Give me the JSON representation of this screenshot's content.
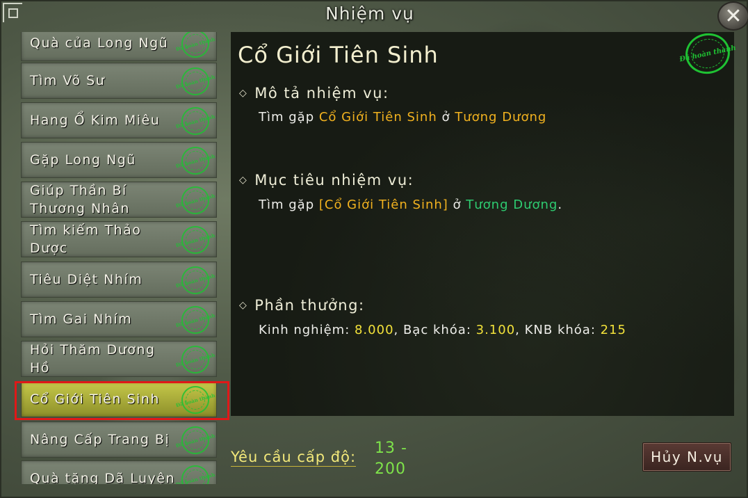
{
  "window": {
    "title": "Nhiệm vụ",
    "close_symbol": "✕"
  },
  "quest_list": {
    "items": [
      {
        "label": "Quà của Long Ngũ",
        "status": "Đã hoàn thành"
      },
      {
        "label": "Tìm Võ Sư",
        "status": "Đã hoàn thành"
      },
      {
        "label": "Hang Ổ Kim Miêu",
        "status": "Đã hoàn thành"
      },
      {
        "label": "Gặp Long Ngũ",
        "status": "Đã hoàn thành"
      },
      {
        "label": "Giúp Thần Bí Thương Nhân",
        "status": "Đã hoàn thành"
      },
      {
        "label": "Tìm kiếm Thảo Dược",
        "status": "Đã hoàn thành"
      },
      {
        "label": "Tiêu Diệt Nhím",
        "status": "Đã hoàn thành"
      },
      {
        "label": "Tìm Gai Nhím",
        "status": "Đã hoàn thành"
      },
      {
        "label": "Hỏi Thăm Dương Hồ",
        "status": "Đã hoàn thành"
      },
      {
        "label": "Cổ Giới Tiên Sinh",
        "status": "Đã hoàn thành",
        "selected": true
      },
      {
        "label": "Nâng Cấp Trang Bị",
        "status": "Đã hoàn thành"
      },
      {
        "label": "Quà tặng Dã Luyện",
        "status": "Đã hoàn thành"
      }
    ]
  },
  "detail": {
    "title": "Cổ Giới Tiên Sinh",
    "status_stamp": "Đã hoàn thành",
    "description": {
      "heading": "Mô tả nhiệm vụ:",
      "prefix": "Tìm gặp ",
      "npc": "Cổ Giới Tiên Sinh",
      "middle": " ở ",
      "location": "Tương Dương"
    },
    "objective": {
      "heading": "Mục tiêu nhiệm vụ:",
      "prefix": "Tìm gặp ",
      "npc": "[Cổ Giới Tiên Sinh]",
      "middle": " ở ",
      "location": "Tương Dương",
      "suffix": "."
    },
    "rewards": {
      "heading": "Phần thưởng:",
      "exp_label": "Kinh nghiệm: ",
      "exp_value": "8.000",
      "silver_label": ", Bạc khóa: ",
      "silver_value": "3.100",
      "knb_label": ", KNB khóa: ",
      "knb_value": "215"
    }
  },
  "footer": {
    "level_label": "Yêu cầu cấp độ:",
    "level_value": "13 - 200",
    "cancel_button": "Hủy N.vụ"
  },
  "colors": {
    "npc_highlight": "#f2b21f",
    "location_green": "#2ecc71",
    "reward_value": "#f3e23a",
    "completed_stamp": "#1fc233",
    "selection_outline": "#e01818"
  }
}
